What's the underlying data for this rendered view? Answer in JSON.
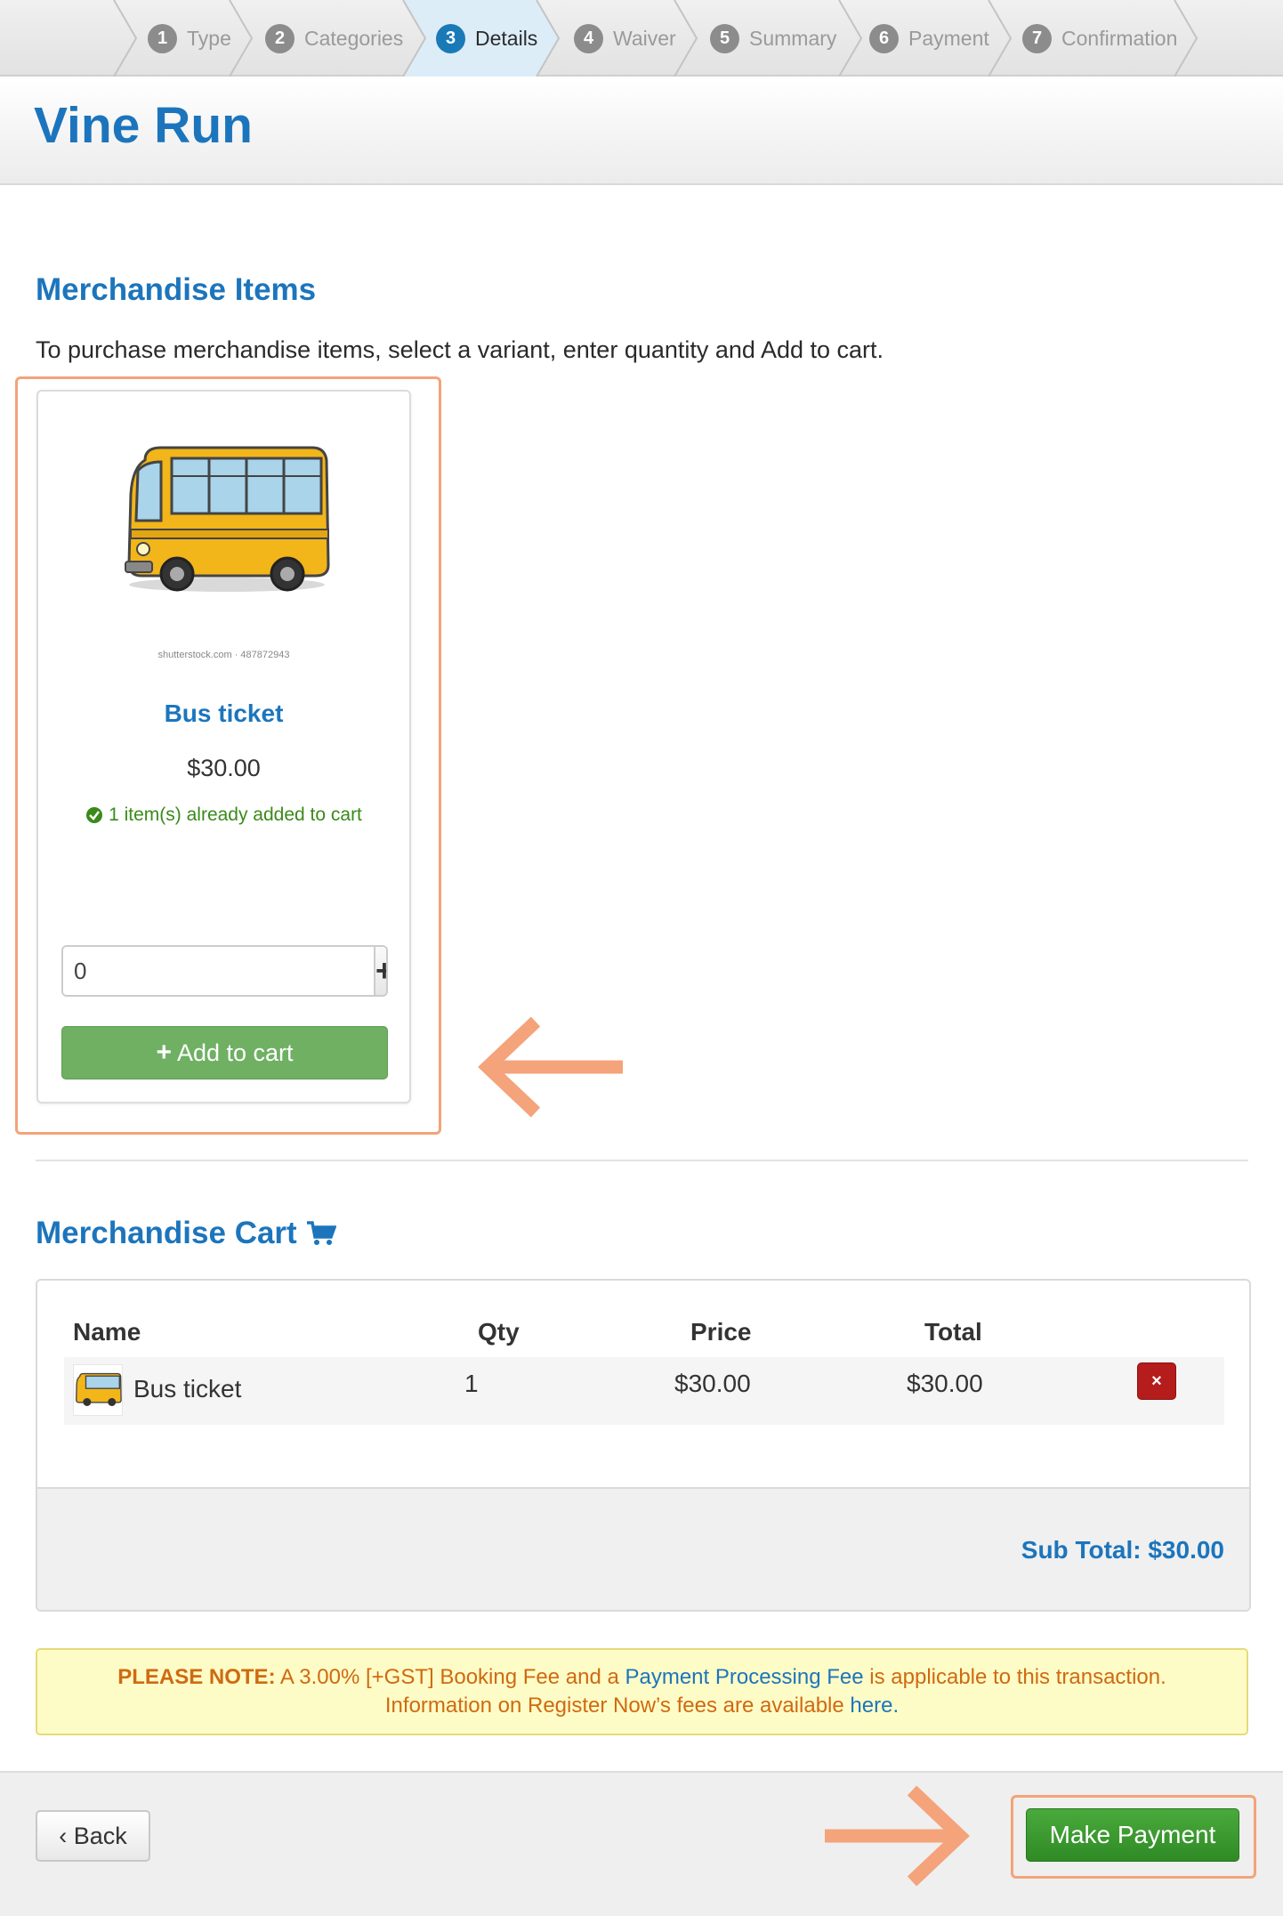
{
  "steps": [
    {
      "num": "1",
      "label": "Type"
    },
    {
      "num": "2",
      "label": "Categories"
    },
    {
      "num": "3",
      "label": "Details"
    },
    {
      "num": "4",
      "label": "Waiver"
    },
    {
      "num": "5",
      "label": "Summary"
    },
    {
      "num": "6",
      "label": "Payment"
    },
    {
      "num": "7",
      "label": "Confirmation"
    }
  ],
  "active_step": "Details",
  "event_title": "Vine Run",
  "merch": {
    "title": "Merchandise Items",
    "intro": "To purchase merchandise items, select a variant, enter quantity and Add to cart.",
    "product": {
      "image_icon": "bus-image",
      "image_credit": "shutterstock.com · 487872943",
      "name": "Bus ticket",
      "price": "$30.00",
      "in_cart_note": "1 item(s) already added to cart",
      "qty_value": "0",
      "plus_label": "+",
      "minus_label": "−",
      "add_label": "Add to cart"
    }
  },
  "cart": {
    "title": "Merchandise Cart",
    "icon": "cart-icon",
    "headers": {
      "name": "Name",
      "qty": "Qty",
      "price": "Price",
      "total": "Total"
    },
    "rows": [
      {
        "name": "Bus ticket",
        "qty": "1",
        "price": "$30.00",
        "total": "$30.00"
      }
    ],
    "remove_label": "×",
    "subtotal": "Sub Total: $30.00"
  },
  "note": {
    "bold": "PLEASE NOTE:",
    "text1": " A 3.00% [+GST] Booking Fee and a ",
    "link1": "Payment Processing Fee",
    "text2": " is applicable to this transaction.",
    "text3": "Information on Register Now’s fees are available ",
    "link2": "here",
    "text4": "."
  },
  "buttons": {
    "back": "‹ Back",
    "pay": "Make Payment"
  },
  "colors": {
    "brand_blue": "#1c75bc",
    "add_green": "#6fb063",
    "pay_green": "#3a9a30",
    "highlight": "#f4a37a",
    "remove_red": "#b51c1c"
  }
}
